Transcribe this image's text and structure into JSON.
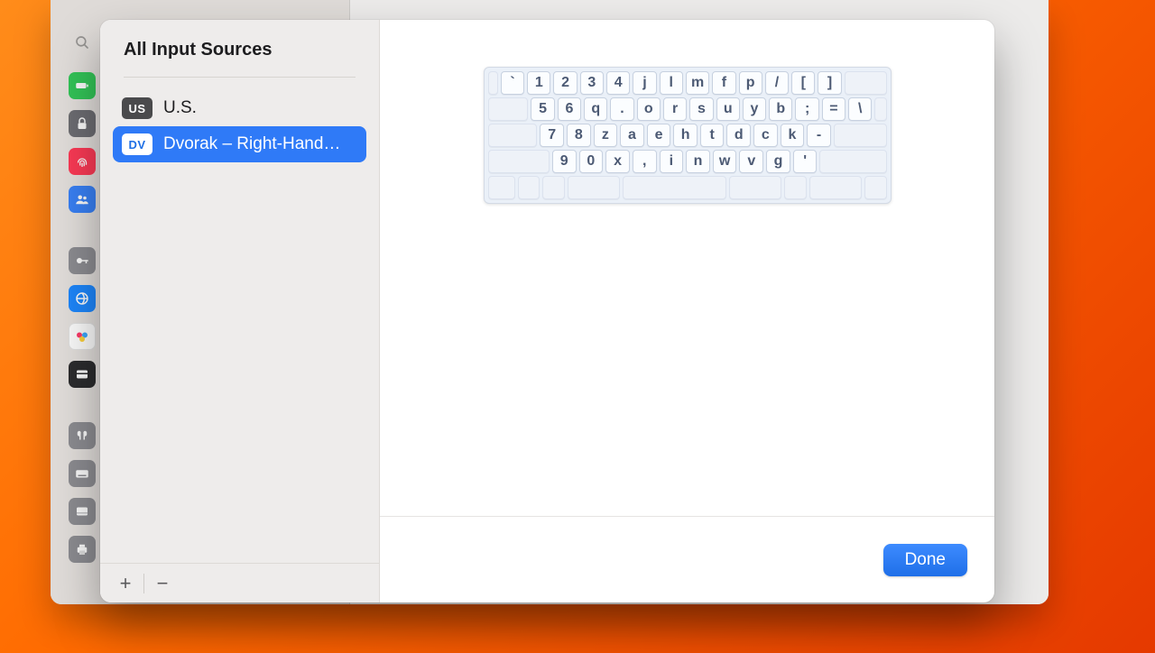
{
  "modal": {
    "title": "All Input Sources",
    "done_label": "Done",
    "add_label": "+",
    "remove_label": "−"
  },
  "sources": [
    {
      "badge": "US",
      "badge_style": "dark",
      "label": "U.S.",
      "selected": false
    },
    {
      "badge": "DV",
      "badge_style": "blue",
      "label": "Dvorak – Right-Hand…",
      "selected": true
    }
  ],
  "keyboard": {
    "rows": [
      {
        "offset": 12,
        "keys": [
          "`",
          "1",
          "2",
          "3",
          "4",
          "j",
          "l",
          "m",
          "f",
          "p",
          "/",
          "[",
          "]"
        ],
        "tail": 50
      },
      {
        "offset": 48,
        "keys": [
          "5",
          "6",
          "q",
          ".",
          "o",
          "r",
          "s",
          "u",
          "y",
          "b",
          ";",
          "=",
          "\\"
        ],
        "tail": 14
      },
      {
        "offset": 58,
        "keys": [
          "7",
          "8",
          "z",
          "a",
          "e",
          "h",
          "t",
          "d",
          "c",
          "k",
          "-"
        ],
        "tail": 62
      },
      {
        "offset": 72,
        "keys": [
          "9",
          "0",
          "x",
          ",",
          "i",
          "n",
          "w",
          "v",
          "g",
          "'"
        ],
        "tail": 78
      }
    ],
    "spacebar_row": {
      "segments": [
        32,
        26,
        26,
        62,
        122,
        62,
        26,
        62,
        26
      ]
    }
  },
  "background_sidebar_icons": [
    {
      "name": "battery",
      "color": "#34c759"
    },
    {
      "name": "lock",
      "color": "#6e6e73"
    },
    {
      "name": "touch-id",
      "color": "#ff3b57"
    },
    {
      "name": "users",
      "color": "#3a82f7"
    },
    {
      "spacer": true
    },
    {
      "name": "passwords",
      "color": "#8e8e93"
    },
    {
      "name": "internet-accounts",
      "color": "#1e88ff"
    },
    {
      "name": "game-center",
      "color": "#ffffff"
    },
    {
      "name": "wallet",
      "color": "#2c2c2e"
    },
    {
      "spacer": true
    },
    {
      "name": "airpods",
      "color": "#8e8e93"
    },
    {
      "name": "keyboard",
      "color": "#8e8e93"
    },
    {
      "name": "trackpad",
      "color": "#8e8e93"
    },
    {
      "name": "printers",
      "color": "#8e8e93"
    }
  ]
}
